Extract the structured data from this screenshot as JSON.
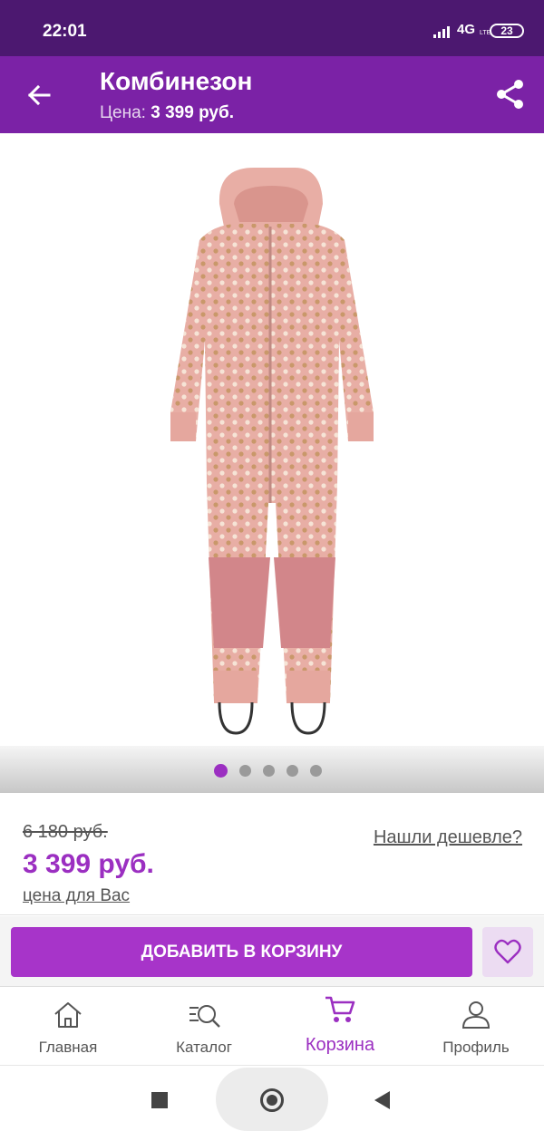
{
  "status_bar": {
    "time": "22:01",
    "network": "4G",
    "network_sub": "LTE",
    "battery": "23"
  },
  "app_bar": {
    "title": "Комбинезон",
    "price_label": "Цена:",
    "price_value": "3 399 руб."
  },
  "gallery": {
    "image_name": "pink-polka-dot-jumpsuit",
    "dots_total": 5,
    "active_dot": 1
  },
  "pricing": {
    "old_price": "6 180 руб.",
    "current_price": "3 399 руб.",
    "for_you_label": "цена для Вас",
    "found_cheaper_link": "Нашли дешевле?"
  },
  "actions": {
    "add_to_cart": "ДОБАВИТЬ В КОРЗИНУ",
    "favorite_icon": "heart-icon"
  },
  "bottom_nav": {
    "items": [
      {
        "label": "Главная",
        "icon": "home-icon"
      },
      {
        "label": "Каталог",
        "icon": "catalog-search-icon"
      },
      {
        "label": "Корзина",
        "icon": "cart-icon",
        "active": true
      },
      {
        "label": "Профиль",
        "icon": "profile-icon"
      }
    ]
  },
  "colors": {
    "status_bar": "#4c1870",
    "app_bar": "#7b22a6",
    "accent": "#9b2fc1",
    "button": "#a734c9",
    "product": "#e8aea5"
  }
}
